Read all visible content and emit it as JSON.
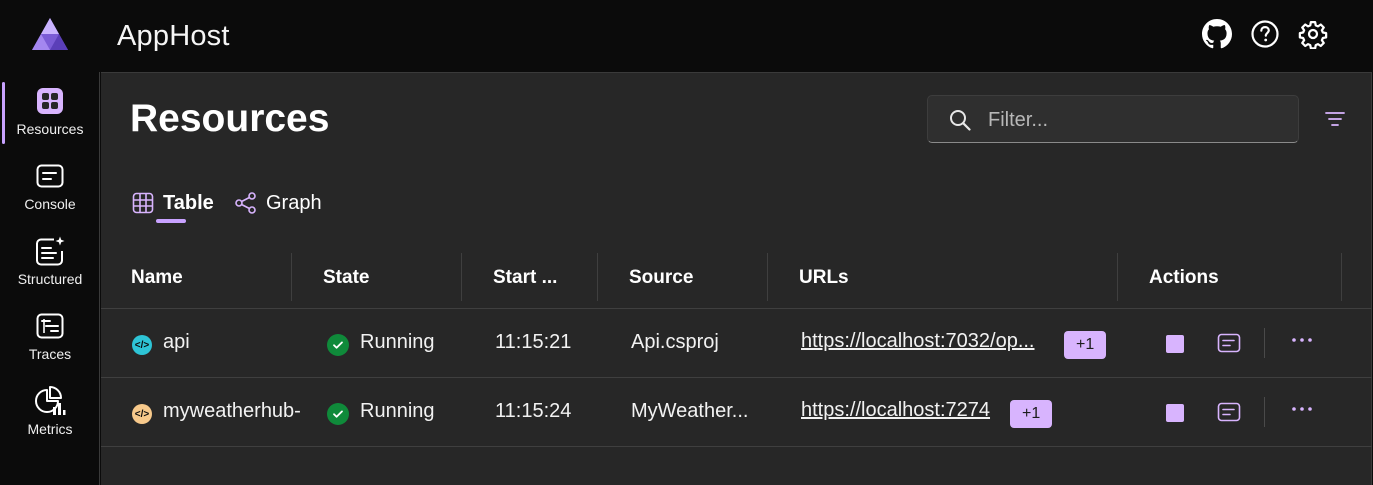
{
  "app": {
    "title": "AppHost"
  },
  "header_icons": [
    "github-icon",
    "help-icon",
    "settings-icon"
  ],
  "sidebar": {
    "items": [
      {
        "label": "Resources",
        "icon": "resources-icon",
        "active": true
      },
      {
        "label": "Console",
        "icon": "console-icon",
        "active": false
      },
      {
        "label": "Structured",
        "icon": "structured-icon",
        "active": false
      },
      {
        "label": "Traces",
        "icon": "traces-icon",
        "active": false
      },
      {
        "label": "Metrics",
        "icon": "metrics-icon",
        "active": false
      }
    ]
  },
  "page": {
    "title": "Resources",
    "filter_placeholder": "Filter...",
    "tabs": [
      {
        "label": "Table",
        "active": true
      },
      {
        "label": "Graph",
        "active": false
      }
    ]
  },
  "table": {
    "columns": [
      "Name",
      "State",
      "Start ...",
      "Source",
      "URLs",
      "Actions"
    ],
    "rows": [
      {
        "name": "api",
        "name_icon_color": "#2ec4d6",
        "state": "Running",
        "start": "11:15:21",
        "source": "Api.csproj",
        "url": "https://localhost:7032/op...",
        "url_extra": "+1"
      },
      {
        "name": "myweatherhub-",
        "name_icon_color": "#f7c98b",
        "state": "Running",
        "start": "11:15:24",
        "source": "MyWeather...",
        "url": "https://localhost:7274",
        "url_extra": "+1"
      }
    ]
  },
  "colors": {
    "accent": "#d8b4fe",
    "running": "#0f8a3a",
    "background": "#272727"
  }
}
